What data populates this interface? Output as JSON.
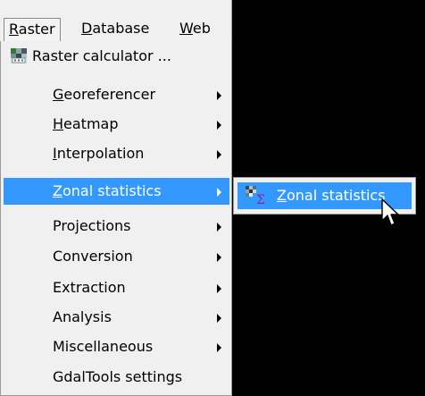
{
  "menubar": {
    "raster": {
      "prefix": "",
      "accel": "R",
      "rest": "aster"
    },
    "database": {
      "prefix": "",
      "accel": "D",
      "rest": "atabase"
    },
    "web": {
      "prefix": "",
      "accel": "W",
      "rest": "eb"
    }
  },
  "menu": {
    "raster_calculator": "Raster calculator ...",
    "georeferencer": {
      "accel": "G",
      "rest": "eoreferencer"
    },
    "heatmap": {
      "accel": "H",
      "rest": "eatmap"
    },
    "interpolation": {
      "accel": "I",
      "rest": "nterpolation"
    },
    "zonal_statistics": {
      "accel": "Z",
      "rest": "onal statistics"
    },
    "projections": "Projections",
    "conversion": "Conversion",
    "extraction": "Extraction",
    "analysis": "Analysis",
    "miscellaneous": "Miscellaneous",
    "gdaltools_settings": "GdalTools settings"
  },
  "submenu": {
    "zonal_statistics": {
      "accel": "Z",
      "rest": "onal statistics"
    }
  },
  "colors": {
    "highlight": "#3399ff",
    "menu_background": "#f0f0f0",
    "canvas_background": "#000000"
  },
  "icons": {
    "raster_calculator": "raster-calculator-icon",
    "zonal_statistics": "zonal-statistics-icon",
    "submenu_arrow": "chevron-right-icon",
    "cursor": "mouse-pointer-icon"
  }
}
